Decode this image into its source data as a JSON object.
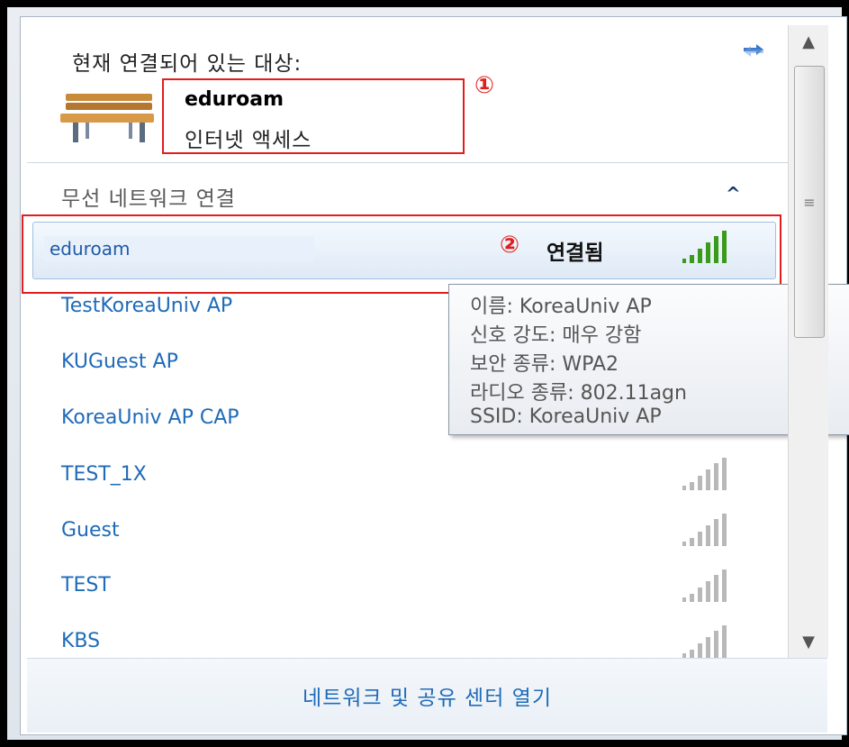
{
  "connected": {
    "title": "현재 연결되어 있는 대상:",
    "network_name": "eduroam",
    "status": "인터넷 액세스",
    "marker": "①"
  },
  "wireless": {
    "section_title": "무선 네트워크 연결",
    "selected": {
      "name": "eduroam",
      "status": "연결됨",
      "marker": "②"
    },
    "networks": [
      {
        "name": "TestKoreaUniv AP"
      },
      {
        "name": "KUGuest AP"
      },
      {
        "name": "KoreaUniv AP CAP"
      },
      {
        "name": "TEST_1X"
      },
      {
        "name": "Guest"
      },
      {
        "name": "TEST"
      },
      {
        "name": "KBS"
      }
    ]
  },
  "tooltip": {
    "lines": [
      "이름: KoreaUniv AP",
      "신호 강도: 매우 강함",
      "보안 종류: WPA2",
      "라디오 종류: 802.11agn",
      "SSID: KoreaUniv AP"
    ]
  },
  "footer": {
    "open_center": "네트워크 및 공유 센터 열기"
  },
  "colors": {
    "accent": "#1f6bb8",
    "highlight_box": "#e21d1d",
    "signal_active": "#3a9a1a",
    "signal_inactive": "#b8b8b8"
  },
  "icons": [
    "refresh-icon",
    "bench-icon",
    "collapse-icon",
    "signal-icon",
    "scroll-up-icon",
    "scroll-down-icon"
  ]
}
